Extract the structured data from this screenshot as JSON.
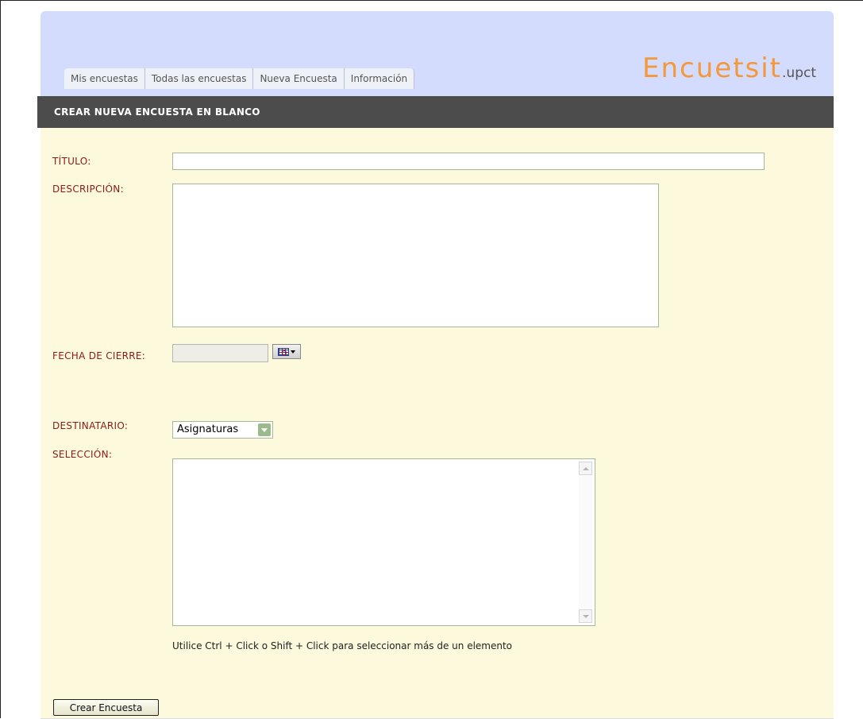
{
  "tabs": [
    "Mis encuestas",
    "Todas las encuestas",
    "Nueva Encuesta",
    "Información"
  ],
  "logo": {
    "main": "Encuetsit",
    "sub": ".upct"
  },
  "section_title": "CREAR NUEVA ENCUESTA EN BLANCO",
  "form": {
    "titulo_label": "TÍTULO:",
    "titulo_value": "",
    "descripcion_label": "DESCRIPCIÓN:",
    "descripcion_value": "",
    "fecha_label": "FECHA DE CIERRE:",
    "fecha_value": "",
    "destinatario_label": "DESTINATARIO:",
    "destinatario_value": "Asignaturas",
    "seleccion_label": "SELECCIÓN:",
    "hint": "Utilice Ctrl + Click o Shift + Click para seleccionar más de un elemento",
    "submit_label": "Crear Encuesta"
  },
  "icons": {
    "calendar": "calendar-icon",
    "dropdown": "chevron-down-icon",
    "scroll_up": "arrow-up-icon",
    "scroll_down": "arrow-down-icon"
  },
  "colors": {
    "header_bg": "#d3dcfc",
    "title_bar_bg": "#4c4c4c",
    "content_bg": "#fcf9dc",
    "label_color": "#8b1a1a",
    "logo_color": "#f4983e"
  }
}
